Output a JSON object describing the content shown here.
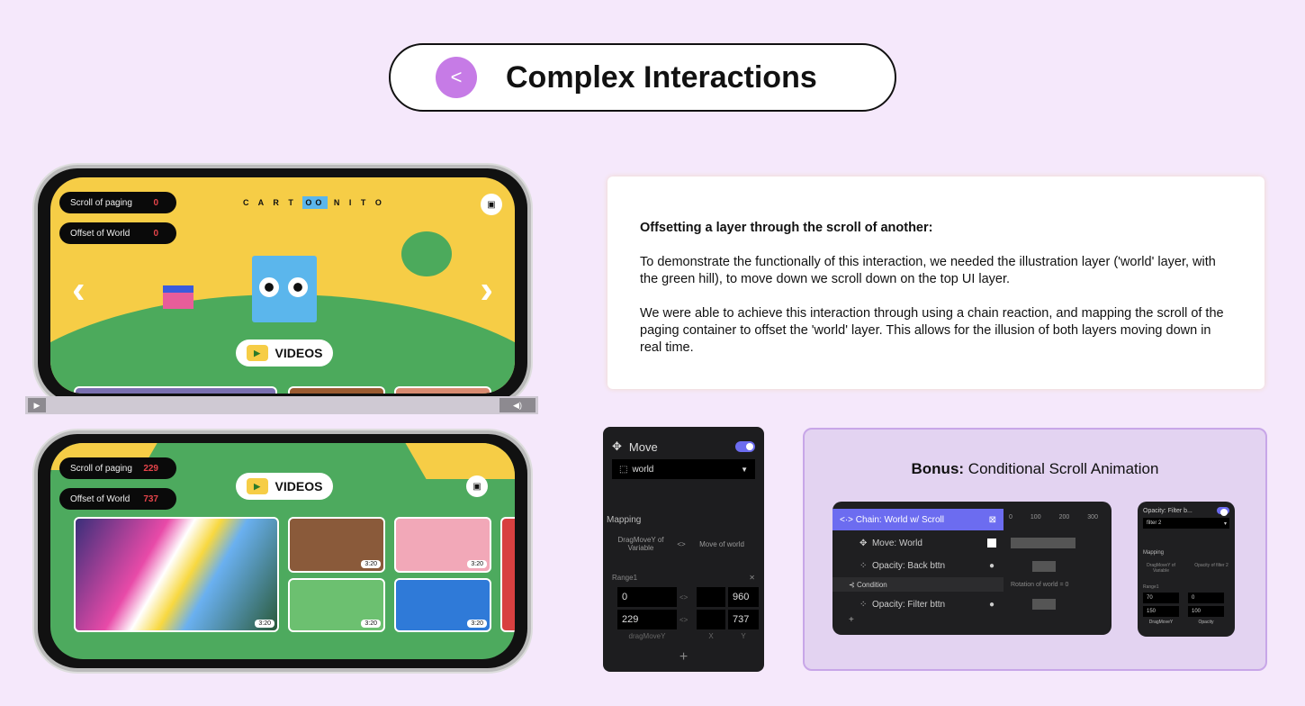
{
  "title": {
    "text": "Complex Interactions",
    "icon": "share-nodes-icon",
    "accent": "#c67be6"
  },
  "description": {
    "heading": "Offsetting a layer through the scroll of another:",
    "p1": "To demonstrate the functionally of this interaction, we needed the illustration layer ('world' layer, with the green hill), to move down we scroll down on the top UI layer.",
    "p2": "We were able to achieve this interaction through using a chain reaction, and mapping the scroll of the paging container to offset the 'world' layer. This allows for the illusion of both layers moving down in real time."
  },
  "phone1": {
    "logo": "CARTOONITO",
    "scroll_label": "Scroll of paging",
    "scroll_value": "0",
    "offset_label": "Offset of World",
    "offset_value": "0",
    "videos": "VIDEOS"
  },
  "phone2": {
    "scroll_label": "Scroll of paging",
    "scroll_value": "229",
    "offset_label": "Offset of World",
    "offset_value": "737",
    "videos": "VIDEOS",
    "durations": [
      "3:20",
      "3:20",
      "3:20",
      "3:20",
      "3:20"
    ]
  },
  "move_panel": {
    "title": "Move",
    "target": "world",
    "mapping": "Mapping",
    "from": "DragMoveY of Variable",
    "arrow": "<>",
    "to": "Move of world",
    "range": "Range1",
    "rows": [
      [
        "0",
        "",
        "960"
      ],
      [
        "229",
        "",
        "737"
      ]
    ],
    "cols": [
      "dragMoveY",
      "X",
      "Y"
    ],
    "add": "+",
    "toggle_on": true
  },
  "bonus": {
    "title_bold": "Bonus:",
    "title_rest": " Conditional Scroll Animation",
    "chain": {
      "header": "Chain: World w/ Scroll",
      "items": [
        "Move: World",
        "Opacity: Back bttn",
        "Condition",
        "Opacity: Filter bttn"
      ],
      "ticks": [
        "0",
        "100",
        "200",
        "300"
      ],
      "condition_text": "Rotation of world = 0"
    },
    "mini": {
      "title": "Opacity: Filter b...",
      "target": "filter 2",
      "mapping": "Mapping",
      "from": "DragMoveY of Variable",
      "to": "Opacity of filter 2",
      "range": "Range1",
      "rows": [
        [
          "70",
          "0"
        ],
        [
          "150",
          "100"
        ]
      ],
      "cols": [
        "DragMoveY",
        "Opacity"
      ]
    }
  }
}
